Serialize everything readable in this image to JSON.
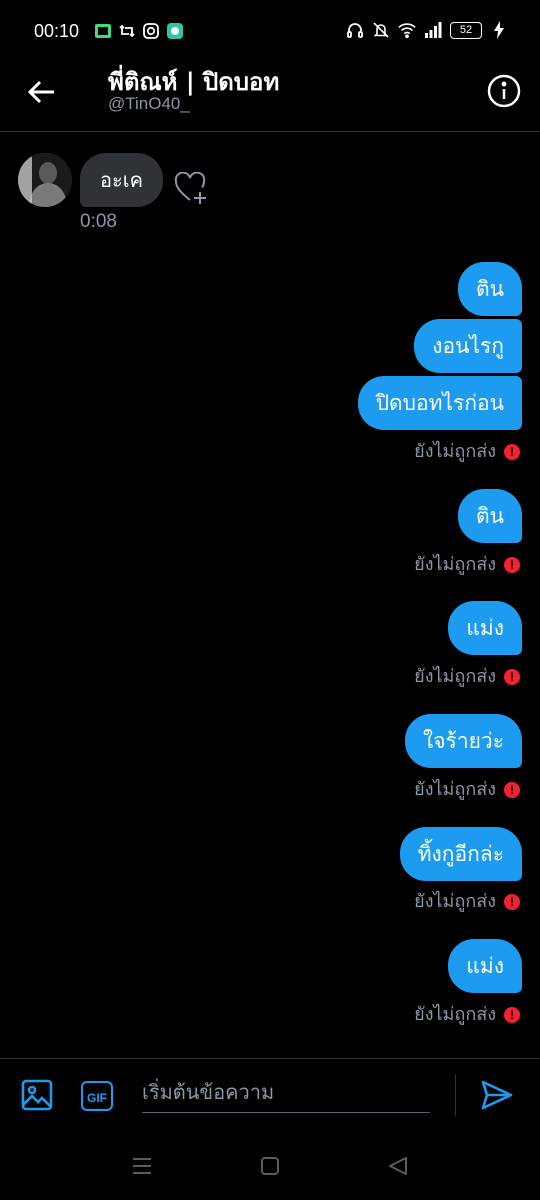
{
  "status_bar": {
    "time": "00:10",
    "battery": "52"
  },
  "header": {
    "title": "พี่ติณห์ | ปิดบอท",
    "handle": "@TinO40_"
  },
  "incoming": {
    "text": "อะเค",
    "time": "0:08"
  },
  "outgoing": [
    {
      "text": "ติน"
    },
    {
      "text": "งอนไรกู"
    },
    {
      "text": "ปิดบอทไรก่อน",
      "status": "ยังไม่ถูกส่ง"
    },
    {
      "text": "ติน",
      "status": "ยังไม่ถูกส่ง"
    },
    {
      "text": "แม่ง",
      "status": "ยังไม่ถูกส่ง"
    },
    {
      "text": "ใจร้ายว่ะ",
      "status": "ยังไม่ถูกส่ง"
    },
    {
      "text": "ทิ้งกูอีกล่ะ",
      "status": "ยังไม่ถูกส่ง"
    },
    {
      "text": "แม่ง",
      "status": "ยังไม่ถูกส่ง"
    }
  ],
  "composer": {
    "placeholder": "เริ่มต้นข้อความ",
    "gif_label": "GIF"
  },
  "colors": {
    "accent": "#1d9bf0",
    "error": "#f4212e",
    "incoming_bubble": "#2f3336",
    "muted_text": "#8b98a5"
  }
}
